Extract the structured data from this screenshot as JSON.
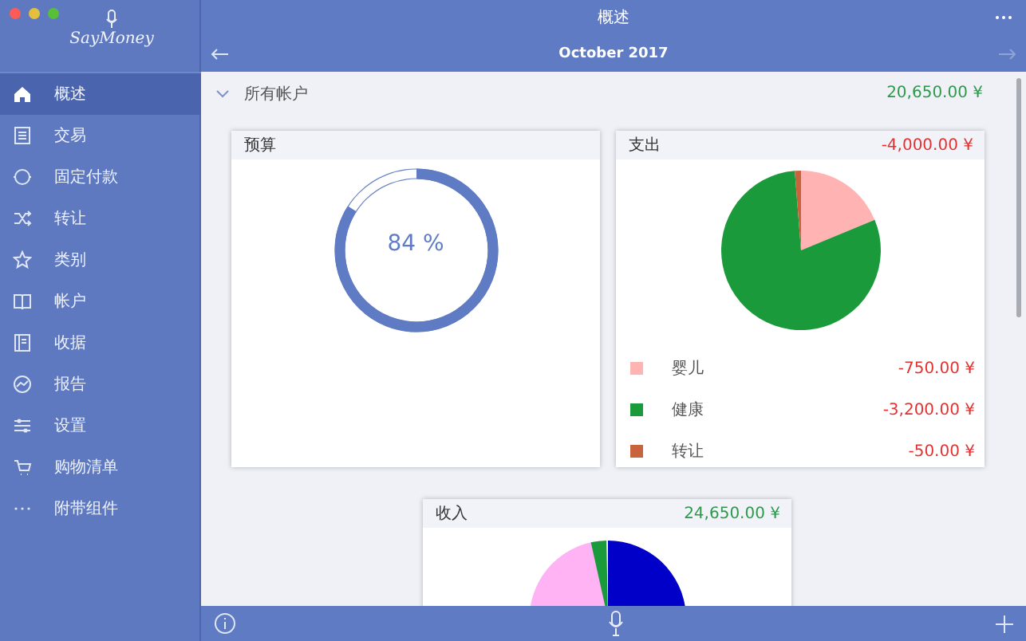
{
  "logo": {
    "text": "SayMoney"
  },
  "sidebar": {
    "items": [
      {
        "label": "概述",
        "selected": true
      },
      {
        "label": "交易",
        "selected": false
      },
      {
        "label": "固定付款",
        "selected": false
      },
      {
        "label": "转让",
        "selected": false
      },
      {
        "label": "类别",
        "selected": false
      },
      {
        "label": "帐户",
        "selected": false
      },
      {
        "label": "收据",
        "selected": false
      },
      {
        "label": "报告",
        "selected": false
      },
      {
        "label": "设置",
        "selected": false
      },
      {
        "label": "购物清单",
        "selected": false
      },
      {
        "label": "附带组件",
        "selected": false
      }
    ]
  },
  "window": {
    "title": "概述"
  },
  "period": {
    "label": "October 2017"
  },
  "account": {
    "label": "所有帐户",
    "total": "20,650.00 ¥"
  },
  "budget": {
    "title": "预算",
    "level": 0.84,
    "reading": "84 %"
  },
  "expenses": {
    "title": "支出",
    "total": "-4,000.00 ¥",
    "chart_data": {
      "type": "pie",
      "categories": [
        "婴儿",
        "健康",
        "转让"
      ],
      "values": [
        18.75,
        80,
        1.25
      ]
    },
    "legend": [
      {
        "amount": "-750.00 ¥",
        "color": "#ffb3b3"
      },
      {
        "amount": "-3,200.00 ¥",
        "color": "#1a9a3a"
      },
      {
        "amount": "-50.00 ¥",
        "color": "#c8643c"
      }
    ]
  },
  "income": {
    "title": "收入",
    "total": "24,650.00 ¥"
  }
}
